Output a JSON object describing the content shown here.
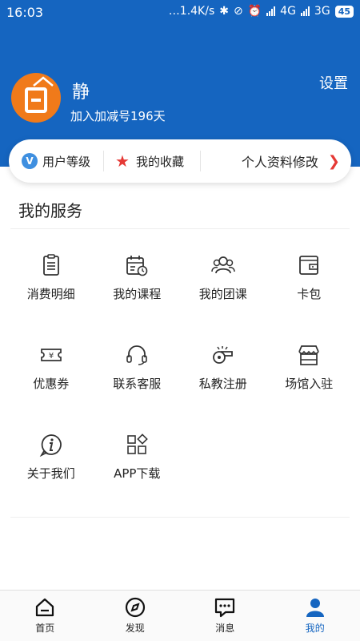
{
  "status_bar": {
    "time": "16:03",
    "network_speed": "…1.4K/s",
    "net1": "4G",
    "net2": "3G",
    "battery": "45"
  },
  "profile": {
    "name": "静",
    "subtitle": "加入加减号196天",
    "settings_label": "设置"
  },
  "card": {
    "level_label": "用户等级",
    "favorites_label": "我的收藏",
    "edit_label": "个人资料修改",
    "vip_badge": "V"
  },
  "services": {
    "title": "我的服务",
    "items": [
      {
        "label": "消费明细",
        "icon": "receipt-icon"
      },
      {
        "label": "我的课程",
        "icon": "calendar-icon"
      },
      {
        "label": "我的团课",
        "icon": "group-icon"
      },
      {
        "label": "卡包",
        "icon": "wallet-icon"
      },
      {
        "label": "优惠券",
        "icon": "coupon-icon"
      },
      {
        "label": "联系客服",
        "icon": "headset-icon"
      },
      {
        "label": "私教注册",
        "icon": "whistle-icon"
      },
      {
        "label": "场馆入驻",
        "icon": "store-icon"
      },
      {
        "label": "关于我们",
        "icon": "info-icon"
      },
      {
        "label": "APP下载",
        "icon": "apps-icon"
      }
    ]
  },
  "tabs": [
    {
      "label": "首页",
      "icon": "home-icon",
      "active": false
    },
    {
      "label": "发现",
      "icon": "compass-icon",
      "active": false
    },
    {
      "label": "消息",
      "icon": "message-icon",
      "active": false
    },
    {
      "label": "我的",
      "icon": "profile-icon",
      "active": true
    }
  ],
  "colors": {
    "primary": "#1565C0",
    "accent": "#E53935",
    "avatar": "#F07A1A"
  }
}
